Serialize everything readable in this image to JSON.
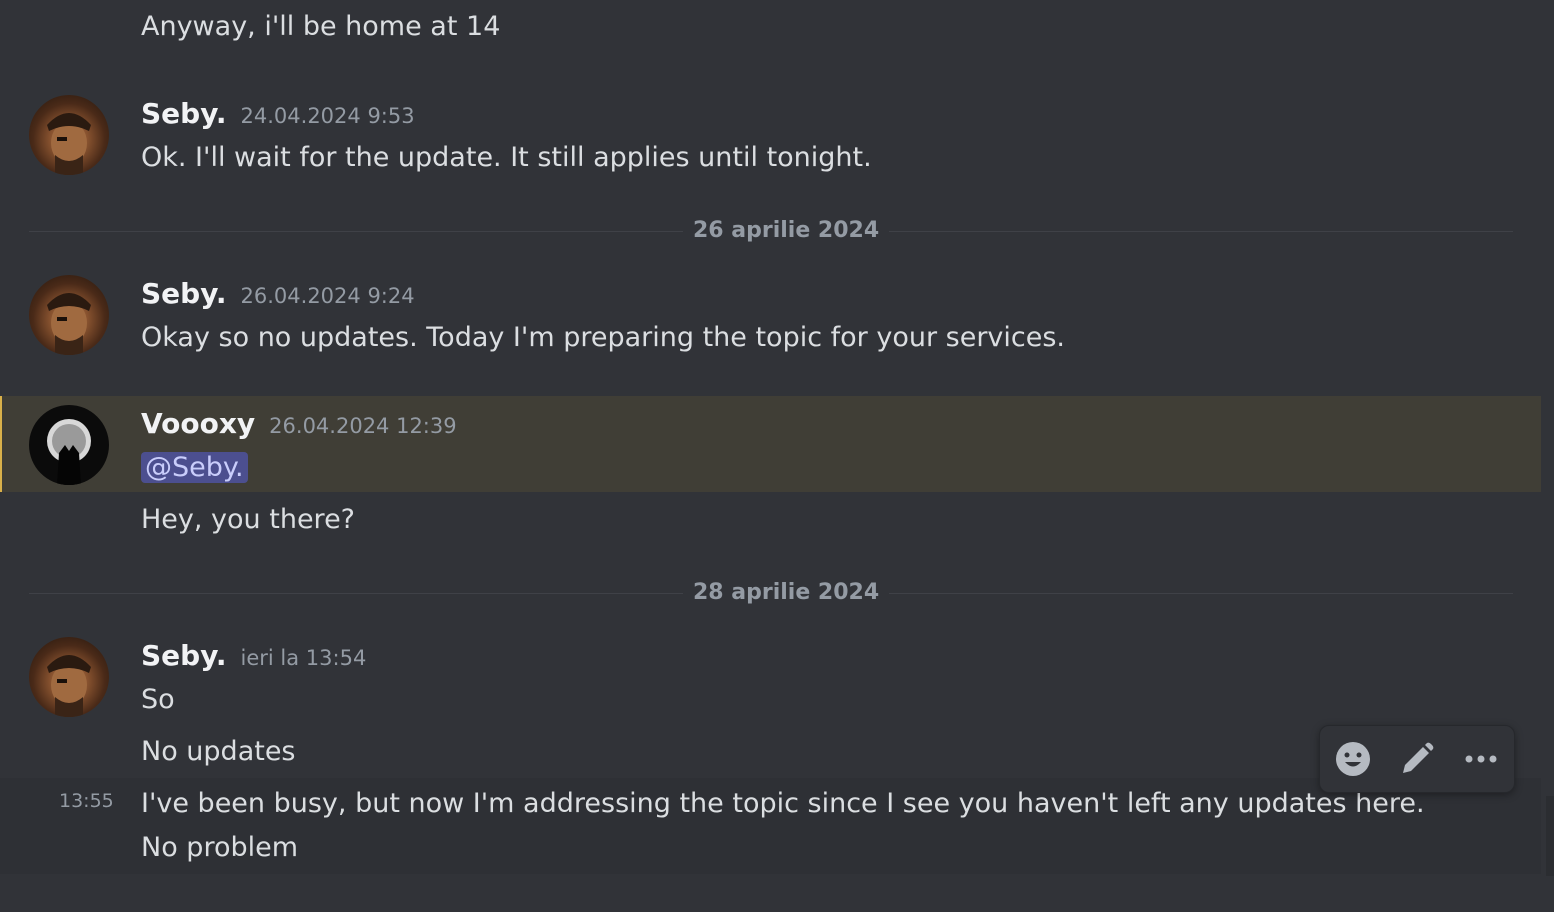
{
  "messages": {
    "top_continuation": "Anyway, i'll be home at 14",
    "m1": {
      "author": "Seby.",
      "timestamp": "24.04.2024 9:53",
      "text": "Ok. I'll wait for the update. It still applies until tonight."
    },
    "divider1": "26 aprilie 2024",
    "m2": {
      "author": "Seby.",
      "timestamp": "26.04.2024 9:24",
      "text": "Okay so no updates. Today I'm preparing the topic for your services."
    },
    "m3": {
      "author": "Voooxy",
      "timestamp": "26.04.2024 12:39",
      "mention": "@Seby.",
      "followup": "Hey, you there?"
    },
    "divider2": "28 aprilie 2024",
    "m4": {
      "author": "Seby.",
      "timestamp": "ieri la 13:54",
      "lines": [
        "So",
        "No updates"
      ],
      "hover_time": "13:55",
      "long_text": "I've been busy, but now I'm addressing the topic since I see you haven't left any updates here. No problem"
    }
  },
  "toolbar": {
    "icons": [
      "emoji-icon",
      "edit-icon",
      "more-icon"
    ]
  },
  "colors": {
    "background": "#313338",
    "mention_bg": "#4c4f8f",
    "highlight_bg": "#403e36",
    "highlight_bar": "#d9b04a"
  }
}
